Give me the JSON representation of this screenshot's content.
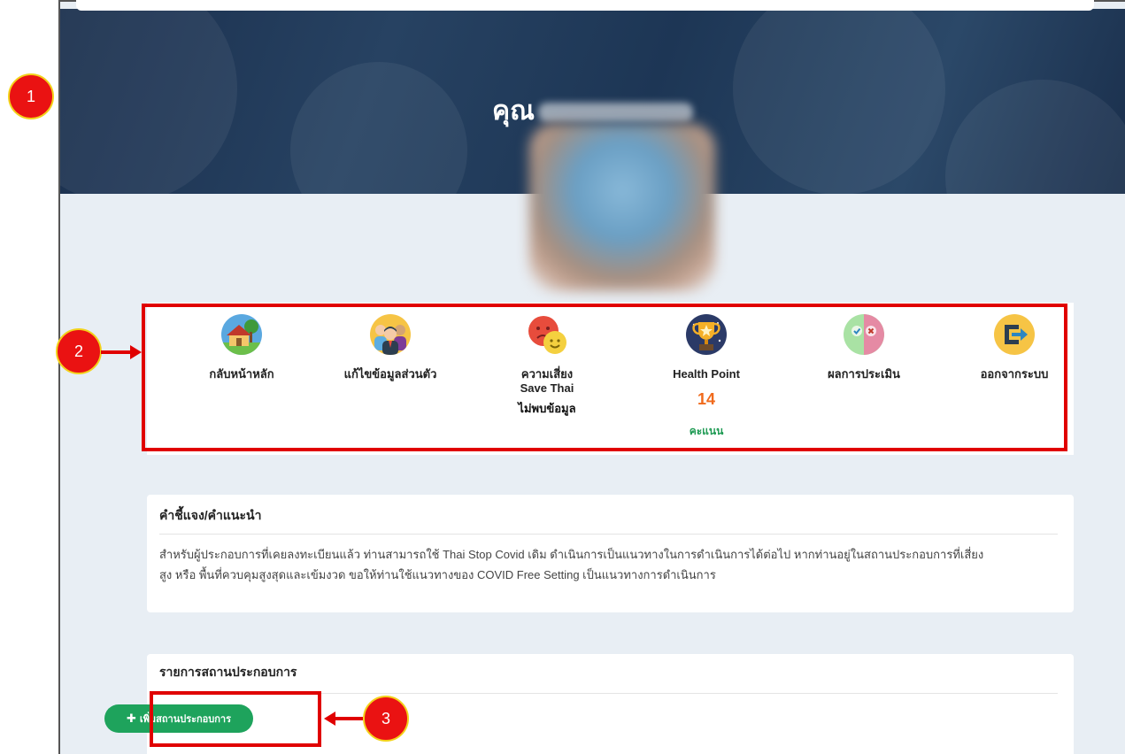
{
  "header": {
    "greeting": "คุณ"
  },
  "menu": {
    "home": {
      "label": "กลับหน้าหลัก",
      "icon": "house-icon"
    },
    "edit_profile": {
      "label": "แก้ไขข้อมูลส่วนตัว",
      "icon": "people-icon"
    },
    "risk": {
      "label": "ความเสี่ยง",
      "sublabel": "Save Thai",
      "status": "ไม่พบข้อมูล",
      "icon": "faces-icon"
    },
    "health_point": {
      "label": "Health Point",
      "value": "14",
      "unit": "คะแนน",
      "icon": "trophy-icon"
    },
    "assessment": {
      "label": "ผลการประเมิน",
      "icon": "assessment-icon"
    },
    "logout": {
      "label": "ออกจากระบบ",
      "icon": "exit-icon"
    }
  },
  "instructions": {
    "title": "คำชี้แจง/คำแนะนำ",
    "line1": "สำหรับผู้ประกอบการที่เคยลงทะเบียนแล้ว ท่านสามารถใช้ Thai Stop Covid เดิม ดำเนินการเป็นแนวทางในการดำเนินการได้ต่อไป หากท่านอยู่ในสถานประกอบการที่เสี่ยง",
    "line2": "สูง หรือ พื้นที่ควบคุมสูงสุดและเข้มงวด ขอให้ท่านใช้แนวทางของ COVID Free Setting เป็นแนวทางการดำเนินการ"
  },
  "business_list": {
    "title": "รายการสถานประกอบการ",
    "add_button": "เพิ่มสถานประกอบการ"
  },
  "callouts": {
    "one": "1",
    "two": "2",
    "three": "3"
  },
  "colors": {
    "banner": "#1f3a5c",
    "accent_red": "#e00000",
    "button_green": "#1ea35c",
    "points_orange": "#f06a1c"
  }
}
